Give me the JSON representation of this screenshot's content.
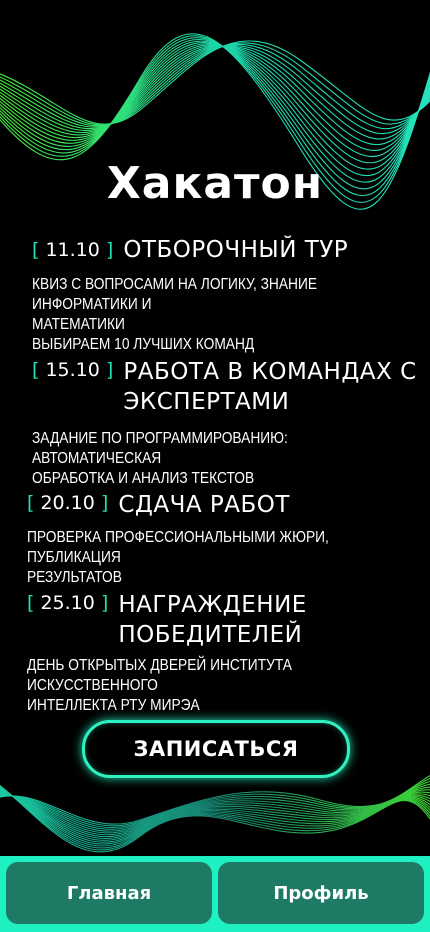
{
  "title": "Хакатон",
  "stages": [
    {
      "date": "11.10",
      "name": "ОТБОРОЧНЫЙ ТУР",
      "desc_lines": [
        "КВИЗ С ВОПРОСАМИ НА ЛОГИКУ, ЗНАНИЕ ИНФОРМАТИКИ И",
        "МАТЕМАТИКИ",
        "ВЫБИРАЕМ 10 ЛУЧШИХ КОМАНД"
      ]
    },
    {
      "date": "15.10",
      "name_lines": [
        "РАБОТА В КОМАНДАХ С",
        "ЭКСПЕРТАМИ"
      ],
      "desc_lines": [
        "ЗАДАНИЕ ПО ПРОГРАММИРОВАНИЮ: АВТОМАТИЧЕСКАЯ",
        "ОБРАБОТКА И АНАЛИЗ ТЕКСТОВ"
      ]
    },
    {
      "date": "20.10",
      "name": "СДАЧА РАБОТ",
      "desc_lines": [
        "ПРОВЕРКА ПРОФЕССИОНАЛЬНЫМИ ЖЮРИ, ПУБЛИКАЦИЯ",
        "РЕЗУЛЬТАТОВ"
      ]
    },
    {
      "date": "25.10",
      "name_lines": [
        "НАГРАЖДЕНИЕ",
        "ПОБЕДИТЕЛЕЙ"
      ],
      "desc_lines": [
        "ДЕНЬ ОТКРЫТЫХ ДВЕРЕЙ ИНСТИТУТА ИСКУССТВЕННОГО",
        "ИНТЕЛЛЕКТА РТУ МИРЭА"
      ]
    }
  ],
  "bracket_open": "[",
  "bracket_close": "]",
  "cta_label": "ЗАПИСАТЬСЯ",
  "nav": {
    "home": "Главная",
    "profile": "Профиль"
  },
  "colors": {
    "accent": "#1fe0b2",
    "nav_bar": "#1ff0c2",
    "nav_button": "#1e7a64",
    "background": "#000000"
  }
}
